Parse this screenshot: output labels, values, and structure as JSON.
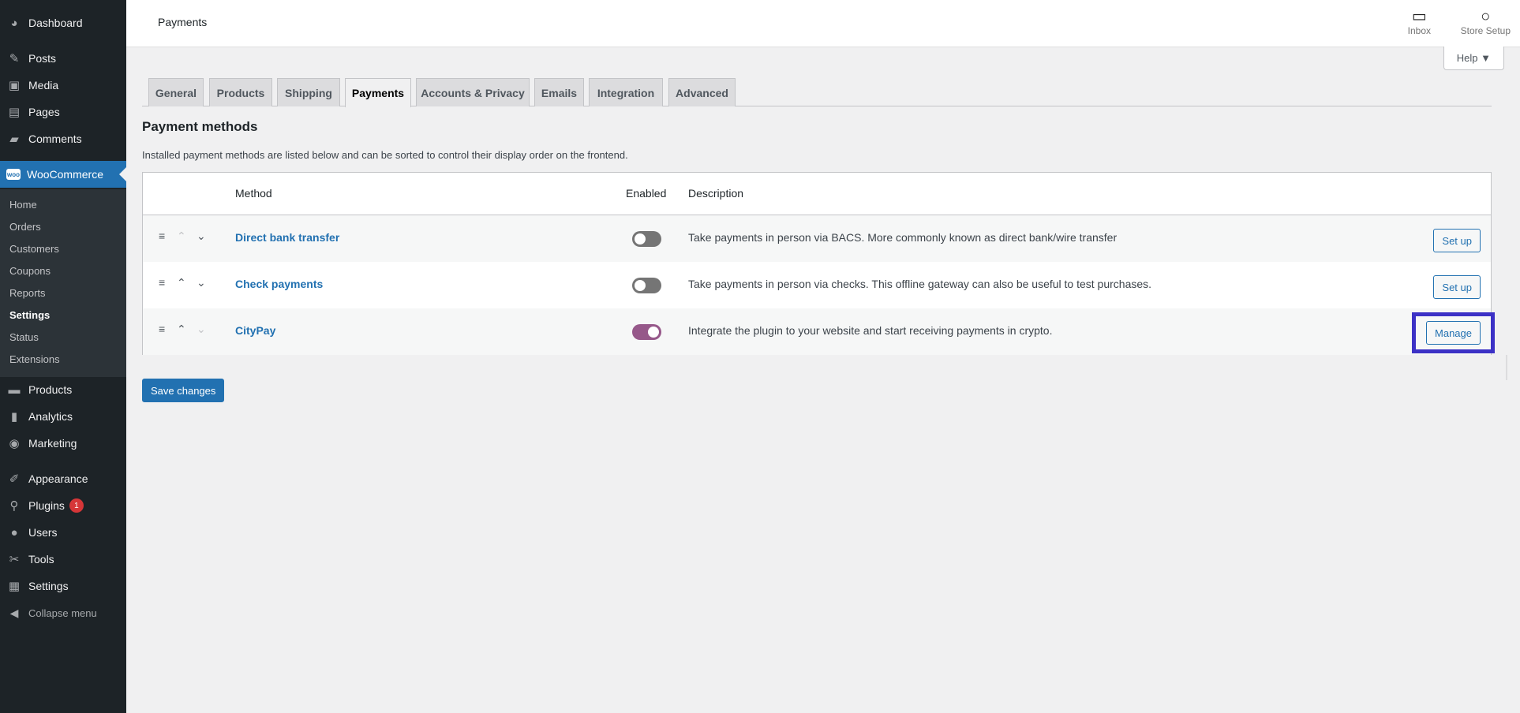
{
  "sidebar": {
    "top_items": [
      {
        "label": "Dashboard",
        "icon": "dashboard-icon",
        "glyph": "◕"
      },
      {
        "label": "Posts",
        "icon": "pin-icon",
        "glyph": "✎"
      },
      {
        "label": "Media",
        "icon": "media-icon",
        "glyph": "▣"
      },
      {
        "label": "Pages",
        "icon": "pages-icon",
        "glyph": "▤"
      },
      {
        "label": "Comments",
        "icon": "comments-icon",
        "glyph": "▰"
      }
    ],
    "woocommerce": {
      "label": "WooCommerce",
      "icon": "woo-icon",
      "glyph": "woo"
    },
    "submenu": [
      "Home",
      "Orders",
      "Customers",
      "Coupons",
      "Reports",
      "Settings",
      "Status",
      "Extensions"
    ],
    "current_sub": "Settings",
    "lower_items": [
      {
        "label": "Products",
        "icon": "products-icon",
        "glyph": "▬"
      },
      {
        "label": "Analytics",
        "icon": "analytics-icon",
        "glyph": "▮"
      },
      {
        "label": "Marketing",
        "icon": "marketing-icon",
        "glyph": "◉"
      },
      {
        "label": "Appearance",
        "icon": "brush-icon",
        "glyph": "✐"
      },
      {
        "label": "Plugins",
        "icon": "plugins-icon",
        "glyph": "⚲",
        "badge": "1"
      },
      {
        "label": "Users",
        "icon": "users-icon",
        "glyph": "●"
      },
      {
        "label": "Tools",
        "icon": "tools-icon",
        "glyph": "✂"
      },
      {
        "label": "Settings",
        "icon": "settings-icon",
        "glyph": "▦"
      }
    ],
    "collapse": {
      "label": "Collapse menu",
      "glyph": "◀"
    }
  },
  "header": {
    "title": "Payments",
    "inbox": {
      "label": "Inbox",
      "glyph": "▭"
    },
    "store_setup": {
      "label": "Store Setup",
      "glyph": "○"
    },
    "help": "Help ▼"
  },
  "tabs": [
    "General",
    "Products",
    "Shipping",
    "Payments",
    "Accounts & Privacy",
    "Emails",
    "Integration",
    "Advanced"
  ],
  "active_tab": "Payments",
  "section": {
    "title": "Payment methods",
    "description": "Installed payment methods are listed below and can be sorted to control their display order on the frontend."
  },
  "table": {
    "headers": {
      "method": "Method",
      "enabled": "Enabled",
      "description": "Description"
    },
    "rows": [
      {
        "name": "Direct bank transfer",
        "enabled": false,
        "description": "Take payments in person via BACS. More commonly known as direct bank/wire transfer",
        "action": "Set up",
        "up_disabled": true,
        "down_disabled": false
      },
      {
        "name": "Check payments",
        "enabled": false,
        "description": "Take payments in person via checks. This offline gateway can also be useful to test purchases.",
        "action": "Set up",
        "up_disabled": false,
        "down_disabled": false
      },
      {
        "name": "CityPay",
        "enabled": true,
        "description": "Integrate the plugin to your website and start receiving payments in crypto.",
        "action": "Manage",
        "up_disabled": false,
        "down_disabled": true
      }
    ],
    "glyphs": {
      "drag": "≡",
      "up": "⌃",
      "down": "⌄"
    }
  },
  "save_button": "Save changes",
  "colors": {
    "sidebar_bg": "#1d2327",
    "accent": "#2271b1",
    "toggle_on": "#96588a",
    "highlight": "#3c31c6",
    "badge": "#d63638"
  }
}
